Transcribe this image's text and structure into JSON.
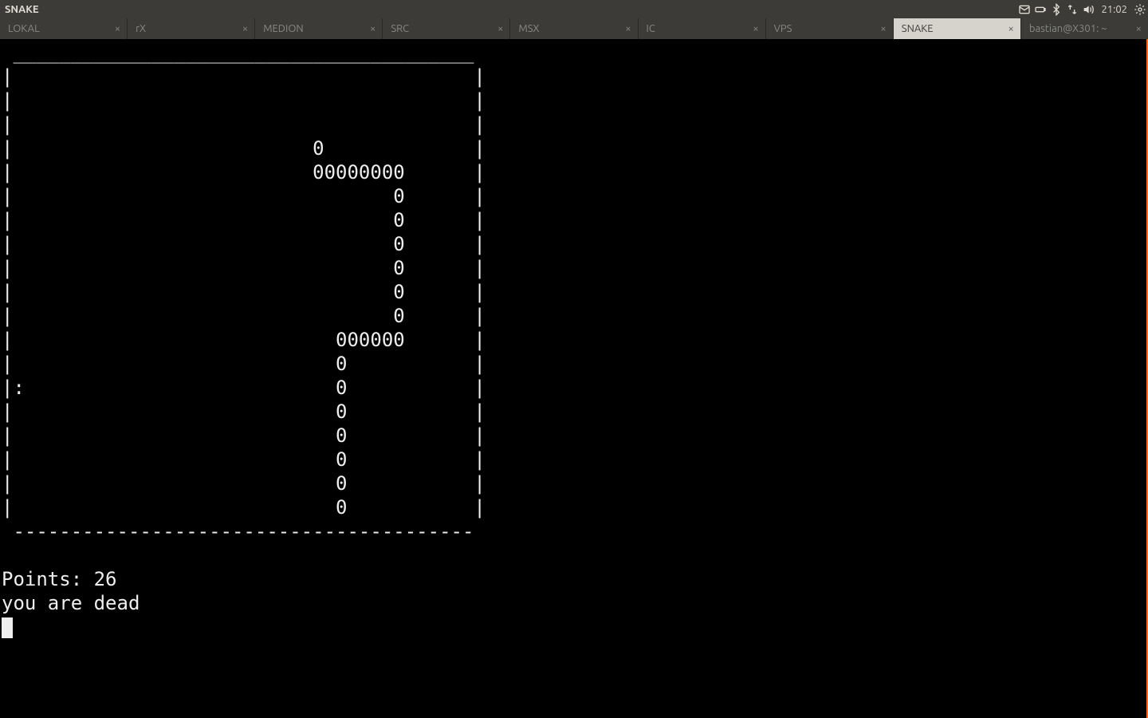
{
  "panel": {
    "title": "SNAKE",
    "clock": "21:02"
  },
  "tabs": [
    {
      "label": "LOKAL",
      "active": false
    },
    {
      "label": "rX",
      "active": false
    },
    {
      "label": "MEDION",
      "active": false
    },
    {
      "label": "SRC",
      "active": false
    },
    {
      "label": "MSX",
      "active": false
    },
    {
      "label": "IC",
      "active": false
    },
    {
      "label": "VPS",
      "active": false
    },
    {
      "label": "SNAKE",
      "active": true
    },
    {
      "label": "bastian@X301: ~",
      "active": false
    }
  ],
  "game": {
    "board_rows": [
      " ________________________________________",
      "|                                        |",
      "|                                        |",
      "|                                        |",
      "|                          0             |",
      "|                          00000000      |",
      "|                                 0      |",
      "|                                 0      |",
      "|                                 0      |",
      "|                                 0      |",
      "|                                 0      |",
      "|                                 0      |",
      "|                            000000      |",
      "|                            0           |",
      "|:                           0           |",
      "|                            0           |",
      "|                            0           |",
      "|                            0           |",
      "|                            0           |",
      "|                            0           |",
      " ----------------------------------------"
    ],
    "points_label": "Points: ",
    "points_value": "26",
    "dead_message": "you are dead"
  }
}
